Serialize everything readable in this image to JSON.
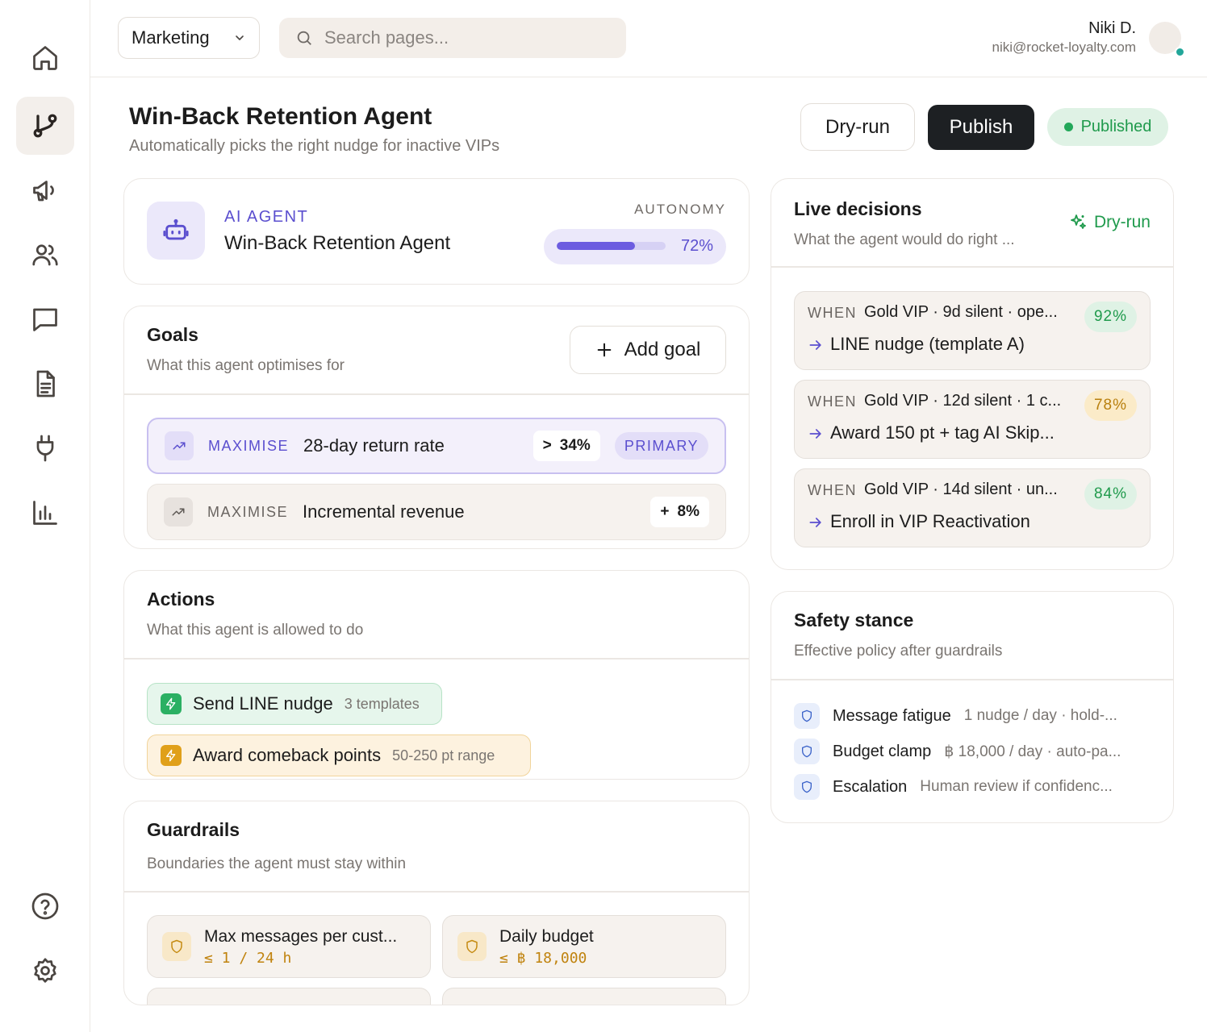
{
  "topbar": {
    "workspace": "Marketing",
    "search_placeholder": "Search pages...",
    "user_name": "Niki D.",
    "user_email": "niki@rocket-loyalty.com"
  },
  "sidebar": {
    "items": [
      {
        "icon": "home-icon"
      },
      {
        "icon": "branch-icon",
        "active": true
      },
      {
        "icon": "megaphone-icon"
      },
      {
        "icon": "users-icon"
      },
      {
        "icon": "chat-icon"
      },
      {
        "icon": "document-icon"
      },
      {
        "icon": "plug-icon"
      },
      {
        "icon": "bar-chart-icon"
      }
    ],
    "bottom": [
      {
        "icon": "help-icon"
      },
      {
        "icon": "settings-icon"
      }
    ]
  },
  "header": {
    "title": "Win-Back Retention Agent",
    "subtitle": "Automatically picks the right nudge for inactive VIPs",
    "dry_run_label": "Dry-run",
    "publish_label": "Publish",
    "status": "Published",
    "status_color": "#23a85a"
  },
  "agent": {
    "kicker": "AI AGENT",
    "name": "Win-Back Retention Agent",
    "autonomy_label": "AUTONOMY",
    "autonomy_value": "72%",
    "autonomy_fraction": 0.72
  },
  "goals": {
    "title": "Goals",
    "subtitle": "What this agent optimises for",
    "add_label": "Add goal",
    "items": [
      {
        "kind": "MAXIMISE",
        "name": "28-day return rate",
        "op": ">",
        "target": "34%",
        "tag": "PRIMARY"
      },
      {
        "kind": "MAXIMISE",
        "name": "Incremental revenue",
        "op": "+",
        "target": "8%"
      }
    ]
  },
  "actions": {
    "title": "Actions",
    "subtitle": "What this agent is allowed to do",
    "items": [
      {
        "label": "Send LINE nudge",
        "meta": "3 templates"
      },
      {
        "label": "Award comeback points",
        "meta": "50-250 pt range"
      }
    ]
  },
  "guardrails": {
    "title": "Guardrails",
    "subtitle": "Boundaries the agent must stay within",
    "items": [
      {
        "name": "Max messages per cust...",
        "value": "≤ 1 / 24 h"
      },
      {
        "name": "Daily budget",
        "value": "≤ ฿ 18,000"
      }
    ]
  },
  "live": {
    "title": "Live decisions",
    "subtitle": "What the agent would do right ...",
    "link_label": "Dry-run",
    "when_label": "WHEN",
    "items": [
      {
        "condition": "Gold VIP · 9d silent · ope...",
        "confidence": "92%",
        "action": "LINE nudge (template A)",
        "tone": "green"
      },
      {
        "condition": "Gold VIP · 12d silent · 1 c...",
        "confidence": "78%",
        "action": "Award 150 pt + tag AI Skip...",
        "tone": "amber"
      },
      {
        "condition": "Gold VIP · 14d silent · un...",
        "confidence": "84%",
        "action": "Enroll in VIP Reactivation",
        "tone": "green"
      }
    ]
  },
  "safety": {
    "title": "Safety stance",
    "subtitle": "Effective policy after guardrails",
    "items": [
      {
        "key": "Message fatigue",
        "value": "1 nudge / day · hold-..."
      },
      {
        "key": "Budget clamp",
        "value": "฿ 18,000 / day · auto-pa..."
      },
      {
        "key": "Escalation",
        "value": "Human review if confidenc..."
      }
    ]
  }
}
